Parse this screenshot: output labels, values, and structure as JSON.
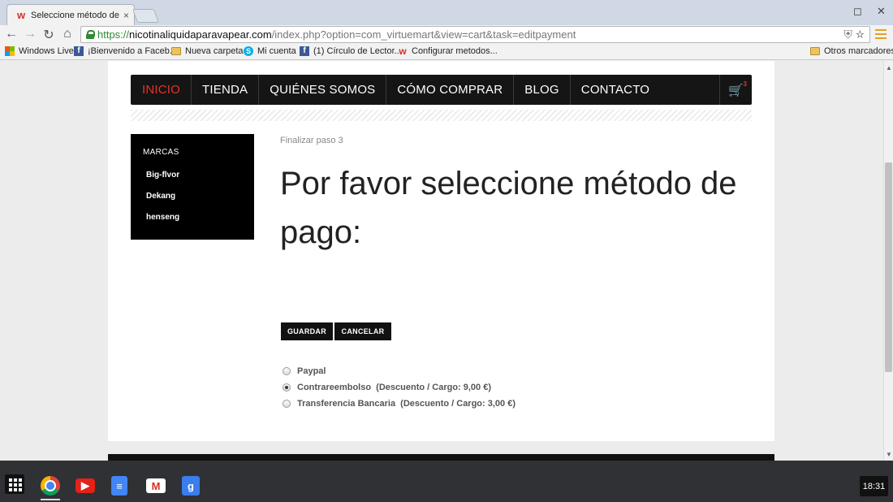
{
  "browser": {
    "tab_title": "Seleccione método de pago",
    "tab_close": "×",
    "url_secure": "https://",
    "url_host": "nicotinaliquidaparavapear.com",
    "url_path": "/index.php?option=com_virtuemart&view=cart&task=editpayment",
    "bookmarks": [
      {
        "label": "Windows Live",
        "icon": "windows-icon"
      },
      {
        "label": "¡Bienvenido a Faceb...",
        "icon": "facebook-icon"
      },
      {
        "label": "Nueva carpeta",
        "icon": "folder-icon"
      },
      {
        "label": "Mi cuenta",
        "icon": "skype-icon"
      },
      {
        "label": "(1) Círculo de Lector...",
        "icon": "facebook-icon"
      },
      {
        "label": "Configurar metodos...",
        "icon": "site-icon"
      }
    ],
    "other_bookmarks": "Otros marcadores"
  },
  "nav": {
    "items": [
      "INICIO",
      "TIENDA",
      "QUIÉNES SOMOS",
      "CÓMO COMPRAR",
      "BLOG",
      "CONTACTO"
    ],
    "active_color": "#e8322a",
    "cart_count": "3"
  },
  "sidebar": {
    "title": "MARCAS",
    "brands": [
      "Big-flvor",
      "Dekang",
      "henseng"
    ]
  },
  "main": {
    "breadcrumb": "Finalizar paso 3",
    "title": "Por favor seleccione método de pago:",
    "save_label": "GUARDAR",
    "cancel_label": "CANCELAR",
    "payment_options": [
      {
        "label": "Paypal",
        "checked": false
      },
      {
        "label": "Contrareembolso  (Descuento / Cargo: 9,00 €)",
        "checked": true
      },
      {
        "label": "Transferencia Bancaria  (Descuento / Cargo: 3,00 €)",
        "checked": false
      }
    ]
  },
  "taskbar": {
    "clock": "18:31",
    "apps": [
      "chrome-icon",
      "youtube-icon",
      "docs-icon",
      "gmail-icon",
      "google-icon"
    ]
  }
}
